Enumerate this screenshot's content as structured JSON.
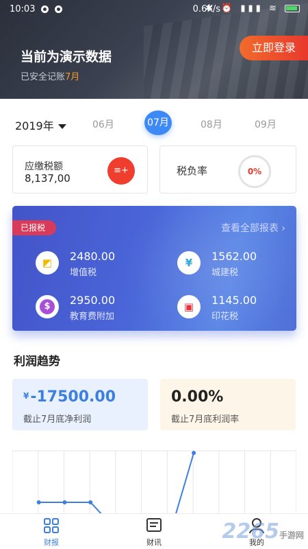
{
  "status": {
    "time": "10:03",
    "net": "0.6K/s",
    "icons": "✱ ⏰ ▮▮▮ ≋"
  },
  "header": {
    "title": "当前为演示数据",
    "sub_prefix": "已安全记账",
    "sub_highlight": "7月",
    "login": "立即登录"
  },
  "months": {
    "year": "2019年",
    "items": [
      "06月",
      "07月",
      "08月",
      "09月"
    ],
    "active": "07月"
  },
  "cards": {
    "tax_due_label": "应缴税额",
    "tax_due_value": "8,137,00",
    "tax_icon": "coin-stack-icon",
    "burden_label": "税负率",
    "burden_value": "0%"
  },
  "reported": {
    "tag": "已报税",
    "view_all": "查看全部报表 ›",
    "items": [
      {
        "amount": "2480.00",
        "name": "增值税",
        "icon": "chart-icon",
        "color": "#f5b800"
      },
      {
        "amount": "1562.00",
        "name": "城建税",
        "icon": "gift-box-icon",
        "color": "#2aa8d6"
      },
      {
        "amount": "2950.00",
        "name": "教育费附加",
        "icon": "dollar-icon",
        "color": "#a94fd6"
      },
      {
        "amount": "1145.00",
        "name": "印花税",
        "icon": "stamp-icon",
        "color": "#e6343f"
      }
    ]
  },
  "profit": {
    "title": "利润趋势",
    "net_currency": "¥",
    "net_value": "-17500.00",
    "net_caption": "截止7月底净利润",
    "rate_value": "0.00%",
    "rate_caption": "截止7月底利润率"
  },
  "chart_data": {
    "type": "line",
    "series": [
      {
        "values": [
          null,
          0.55,
          0.55,
          0.55,
          0.3,
          null,
          0.2,
          1.0
        ]
      }
    ],
    "grid": true
  },
  "tabs": [
    "财报",
    "财讯",
    "我的"
  ],
  "watermark": {
    "brand": "2265",
    "text": "手游网"
  },
  "colors": {
    "accent": "#3d8af7",
    "login": "#ec4f2c",
    "danger": "#e63c2e"
  }
}
